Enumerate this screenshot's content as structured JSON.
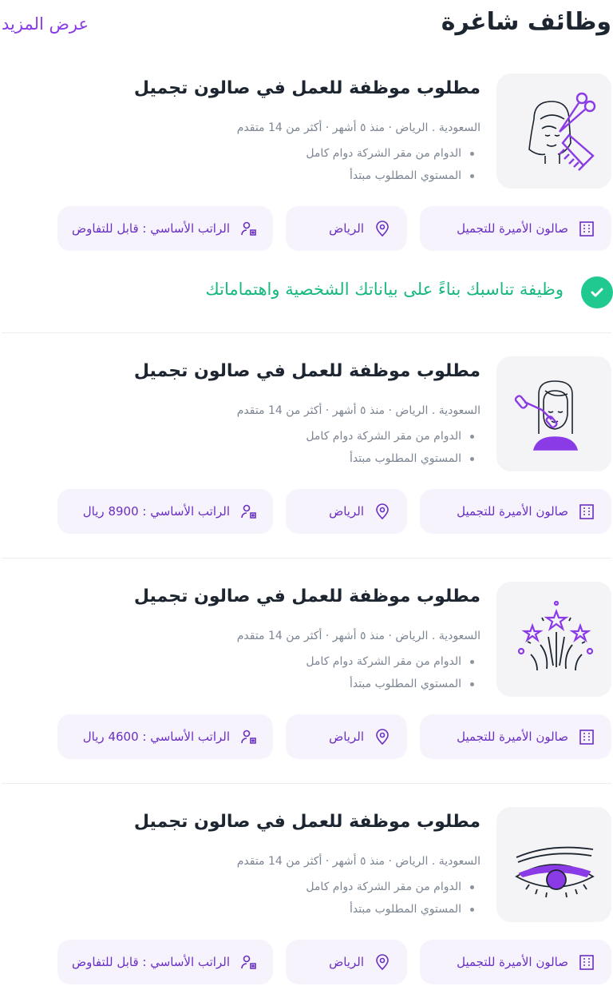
{
  "header": {
    "title": "وظائف شاغرة",
    "see_more": "عرض المزيد"
  },
  "match": {
    "text": "وظيفة تناسبك بناءً على بياناتك الشخصية واهتماماتك",
    "icon": "check-icon"
  },
  "colors": {
    "accent": "#8a3be6",
    "chip_bg": "#f7f3fc",
    "success": "#1fc98f",
    "thumb_bg": "#f4f4f6"
  },
  "jobs": [
    {
      "icon": "hair-stylist-icon",
      "title": "مطلوب موظفة للعمل في صالون تجميل",
      "meta": "السعودية . الرياض · منذ ٥ أشهر · أكثر من 14 متقدم",
      "bullets": [
        "الدوام من مقر الشركة  دوام كامل",
        "المستوي المطلوب مبتدأ"
      ],
      "company": "صالون الأميرة للتجميل",
      "city": "الرياض",
      "salary": "الراتب الأساسي : قابل للتفاوض"
    },
    {
      "icon": "face-roller-icon",
      "title": "مطلوب موظفة للعمل في صالون تجميل",
      "meta": "السعودية . الرياض · منذ ٥ أشهر · أكثر من 14 متقدم",
      "bullets": [
        "الدوام من مقر الشركة  دوام كامل",
        "المستوي المطلوب مبتدأ"
      ],
      "company": "صالون الأميرة للتجميل",
      "city": "الرياض",
      "salary": "الراتب الأساسي : 8900 ريال"
    },
    {
      "icon": "sparkle-stars-icon",
      "title": "مطلوب موظفة للعمل في صالون تجميل",
      "meta": "السعودية . الرياض · منذ ٥ أشهر · أكثر من 14 متقدم",
      "bullets": [
        "الدوام من مقر الشركة  دوام كامل",
        "المستوي المطلوب مبتدأ"
      ],
      "company": "صالون الأميرة للتجميل",
      "city": "الرياض",
      "salary": "الراتب الأساسي : 4600 ريال"
    },
    {
      "icon": "eye-makeup-icon",
      "title": "مطلوب موظفة للعمل في صالون تجميل",
      "meta": "السعودية . الرياض · منذ ٥ أشهر · أكثر من 14 متقدم",
      "bullets": [
        "الدوام من مقر الشركة  دوام كامل",
        "المستوي المطلوب مبتدأ"
      ],
      "company": "صالون الأميرة للتجميل",
      "city": "الرياض",
      "salary": "الراتب الأساسي : قابل للتفاوض"
    }
  ]
}
